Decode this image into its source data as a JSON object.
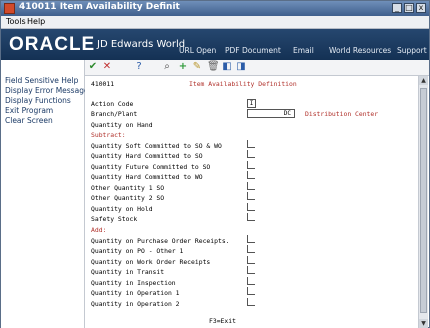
{
  "window": {
    "title": "410011   Item Availability Definit"
  },
  "menu": {
    "tools": "Tools",
    "help": "Help"
  },
  "banner": {
    "logo": "ORACLE",
    "product": "JD Edwards World",
    "links": [
      "URL Open",
      "PDF Document",
      "Email",
      "World Resources",
      "Support"
    ]
  },
  "left_menu": [
    "Field Sensitive Help",
    "Display Error Message",
    "Display Functions",
    "Exit Program",
    "Clear Screen"
  ],
  "form": {
    "program_id": "410011",
    "title": "Item Availability Definition",
    "action_code_label": "Action Code",
    "action_code_value": "I",
    "branch_label": "Branch/Plant",
    "branch_value": "DC",
    "branch_desc": "Distribution Center",
    "qty_on_hand_label": "Quantity on Hand",
    "subtract_heading": "Subtract:",
    "subtract_items": [
      "Quantity Soft Committed to SO & WO",
      "Quantity Hard Committed to SO",
      "Quantity Future Committed to SO",
      "Quantity Hard Committed to WO",
      "Other Quantity 1 SO",
      "Other Quantity 2 SO",
      "Quantity on Hold",
      "Safety Stock"
    ],
    "add_heading": "Add:",
    "add_items": [
      "Quantity on Purchase Order Receipts.",
      "Quantity on PO - Other 1",
      "Quantity on Work Order Receipts",
      "Quantity in Transit",
      "Quantity in Inspection",
      "Quantity in Operation 1",
      "Quantity in Operation 2"
    ],
    "footer": "F3=Exit"
  }
}
